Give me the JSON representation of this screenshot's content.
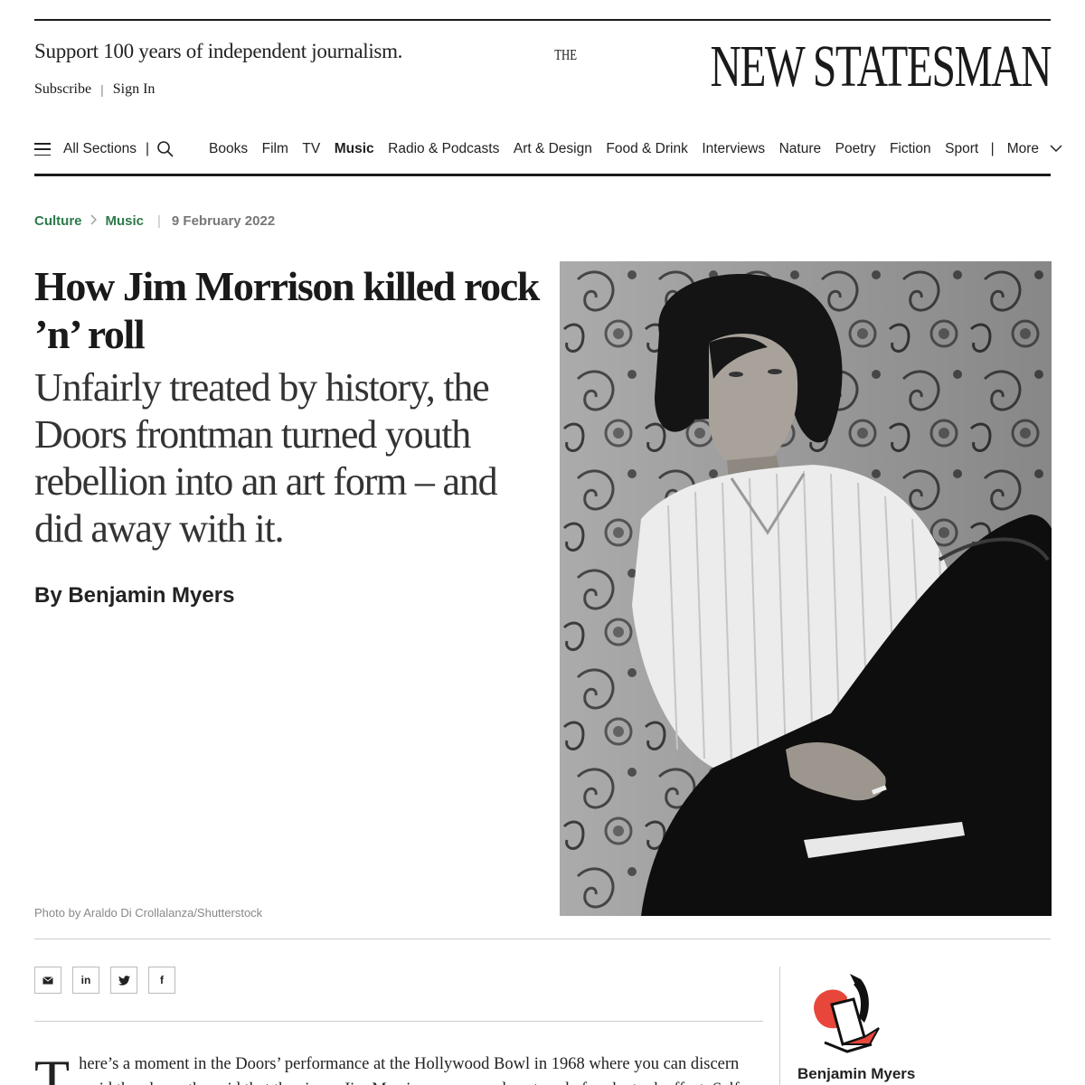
{
  "header": {
    "support_text": "Support 100 years of independent journalism.",
    "subscribe": "Subscribe",
    "separator": "|",
    "sign_in": "Sign In",
    "logo_the": "THE",
    "logo_name": "NEW STATESMAN"
  },
  "nav": {
    "all_sections": "All Sections",
    "separator": "|",
    "items": [
      "Books",
      "Film",
      "TV",
      "Music",
      "Radio & Podcasts",
      "Art & Design",
      "Food & Drink",
      "Interviews",
      "Nature",
      "Poetry",
      "Fiction",
      "Sport"
    ],
    "active_item": "Music",
    "more": "More",
    "icons": [
      "menu-icon",
      "search-icon",
      "chevron-down-icon"
    ]
  },
  "breadcrumb": {
    "section": "Culture",
    "subsection": "Music",
    "date": "9 February 2022"
  },
  "article": {
    "headline": "How Jim Morrison killed rock ’n’ roll",
    "standfirst": "Unfairly treated by history, the Doors frontman turned youth rebellion into an art form – and did away with it.",
    "byline": "By Benjamin Myers",
    "photo_caption": "Photo by Araldo Di Crollalanza/Shutterstock",
    "body_dropcap": "T",
    "body_text": "here’s a moment in the Doors’ performance at the Hollywood Bowl in 1968 where you can discern amid the gloom the acid that the singer Jim Morrison consumed onstage before he took effect. Self-"
  },
  "share": {
    "icons": [
      "email-icon",
      "linkedin-icon",
      "twitter-icon",
      "facebook-icon"
    ],
    "linkedin_glyph": "in",
    "facebook_glyph": "f"
  },
  "author_card": {
    "name": "Benjamin Myers"
  },
  "colors": {
    "breadcrumb_green": "#2d7a4b",
    "illustration_red": "#e8463a",
    "text": "#1a1a1a"
  }
}
